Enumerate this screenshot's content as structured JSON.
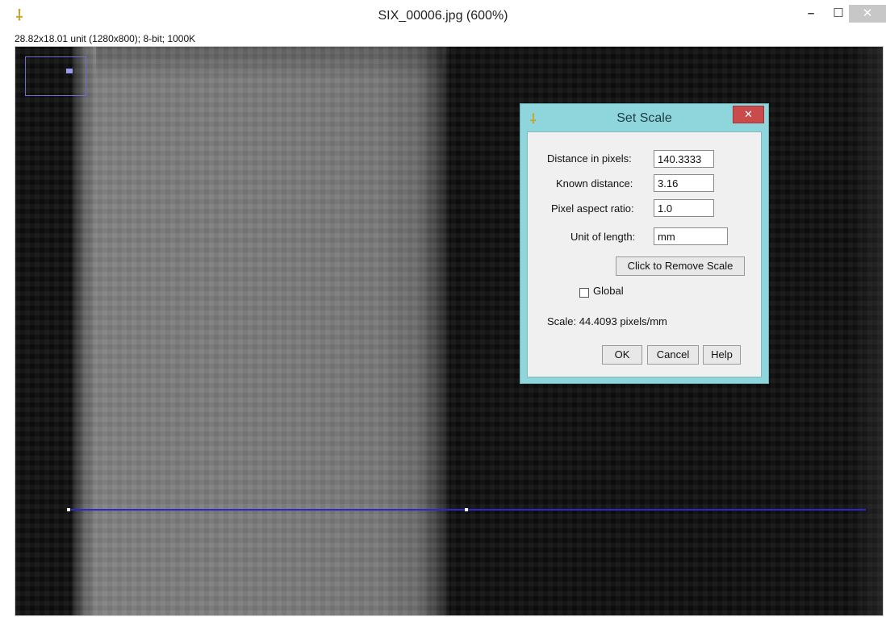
{
  "window": {
    "title": "SIX_00006.jpg (600%)",
    "info": "28.82x18.01 unit (1280x800); 8-bit; 1000K",
    "minimize_glyph": "–",
    "maximize_glyph": "☐",
    "close_glyph": "✕",
    "app_icon": "microscope-icon"
  },
  "dialog": {
    "title": "Set Scale",
    "close_glyph": "✕",
    "fields": {
      "distance_label": "Distance in pixels:",
      "distance_value": "140.3333",
      "known_label": "Known distance:",
      "known_value": "3.16",
      "aspect_label": "Pixel aspect ratio:",
      "aspect_value": "1.0",
      "unit_label": "Unit of length:",
      "unit_value": "mm"
    },
    "remove_scale_label": "Click to Remove Scale",
    "global_label": "Global",
    "global_checked": false,
    "scale_text": "Scale: 44.4093 pixels/mm",
    "ok_label": "OK",
    "cancel_label": "Cancel",
    "help_label": "Help"
  },
  "colors": {
    "dialog_frame": "#8fd6dc",
    "selection_line": "#2a2ac0",
    "close_red": "#c94b4b"
  }
}
